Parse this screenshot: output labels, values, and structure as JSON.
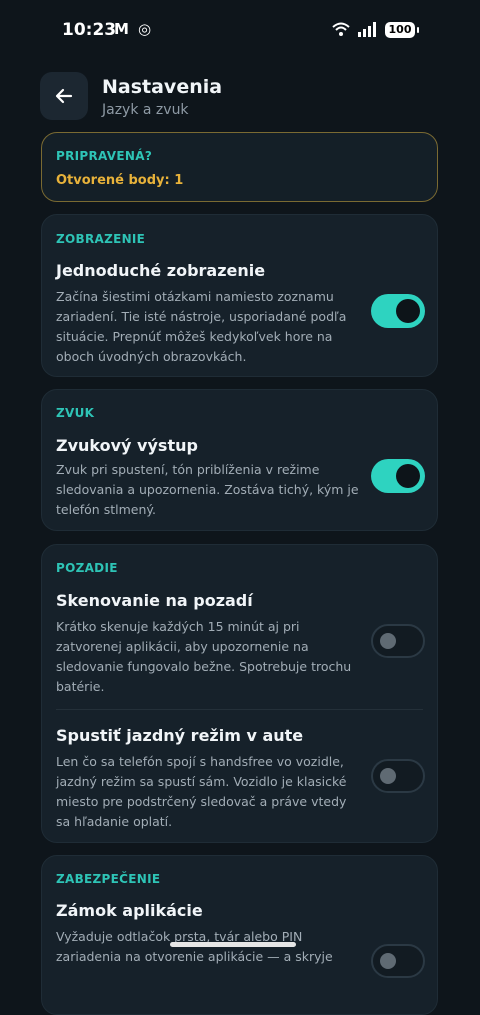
{
  "status_bar": {
    "time": "10:23",
    "battery": "100"
  },
  "header": {
    "title": "Nastavenia",
    "subtitle": "Jazyk a zvuk"
  },
  "ready_card": {
    "label": "PRIPRAVENÁ?",
    "status": "Otvorené body: 1"
  },
  "display_section": {
    "label": "ZOBRAZENIE",
    "setting": {
      "title": "Jednoduché zobrazenie",
      "description": "Začína šiestimi otázkami namiesto zoznamu zariadení. Tie isté nástroje, usporiadané podľa situácie. Prepnúť môžeš kedykoľvek hore na oboch úvodných obrazovkách.",
      "enabled": true
    }
  },
  "sound_section": {
    "label": "ZVUK",
    "setting": {
      "title": "Zvukový výstup",
      "description": "Zvuk pri spustení, tón priblíženia v režime sledovania a upozornenia. Zostáva tichý, kým je telefón stlmený.",
      "enabled": true
    }
  },
  "background_section": {
    "label": "POZADIE",
    "settings": [
      {
        "title": "Skenovanie na pozadí",
        "description": "Krátko skenuje každých 15 minút aj pri zatvorenej aplikácii, aby upozornenie na sledovanie fungovalo bežne. Spotrebuje trochu batérie.",
        "enabled": false
      },
      {
        "title": "Spustiť jazdný režim v aute",
        "description": "Len čo sa telefón spojí s handsfree vo vozidle, jazdný režim sa spustí sám. Vozidlo je klasické miesto pre podstrčený sledovač a práve vtedy sa hľadanie oplatí.",
        "enabled": false
      }
    ]
  },
  "security_section": {
    "label": "ZABEZPEČENIE",
    "setting": {
      "title": "Zámok aplikácie",
      "description": "Vyžaduje odtlačok prsta, tvár alebo PIN zariadenia na otvorenie aplikácie — a skryje",
      "enabled": false
    }
  },
  "colors": {
    "accent": "#2ec4b6",
    "toggle_on": "#2ed3c0",
    "warning": "#e8b23a",
    "background": "#0e151b",
    "card": "#16212a"
  }
}
